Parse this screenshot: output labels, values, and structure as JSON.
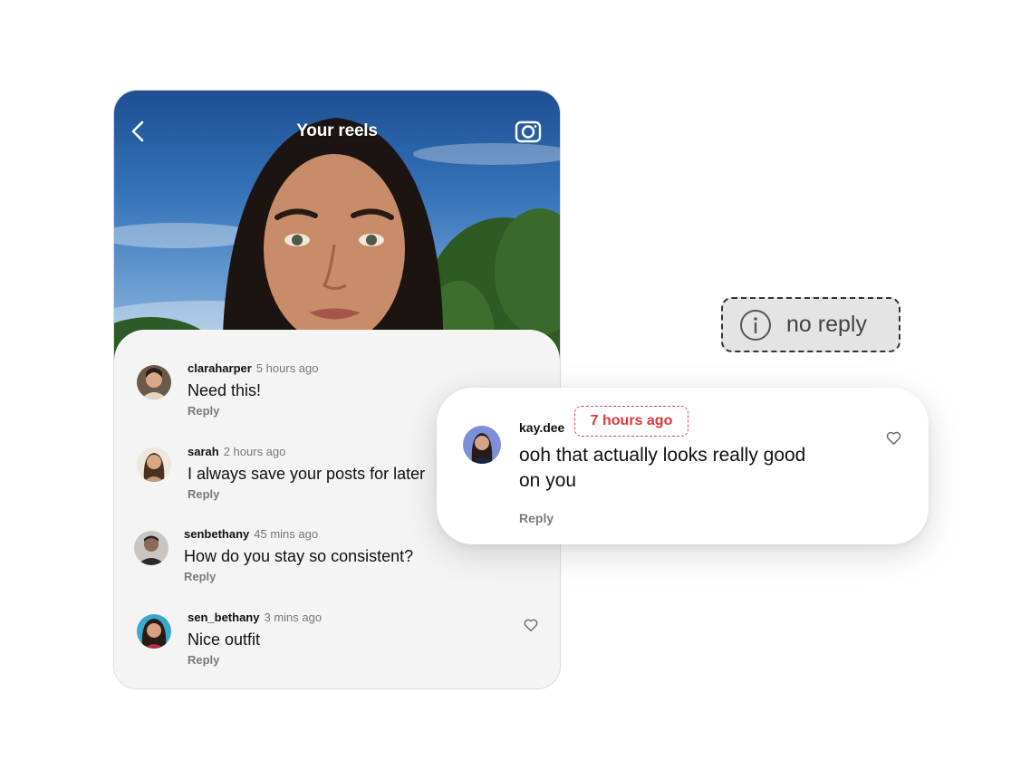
{
  "header": {
    "title": "Your reels"
  },
  "comments": [
    {
      "user": "claraharper",
      "time": "5 hours ago",
      "text": "Need this!",
      "reply": "Reply"
    },
    {
      "user": "sarah",
      "time": "2 hours ago",
      "text": "I always save your posts for later",
      "reply": "Reply"
    },
    {
      "user": "senbethany",
      "time": "45 mins ago",
      "text": "How do you stay so consistent?",
      "reply": "Reply"
    },
    {
      "user": "sen_bethany",
      "time": "3 mins ago",
      "text": "Nice outfit",
      "reply": "Reply"
    }
  ],
  "status_pill": {
    "icon": "info-icon",
    "text": "no reply"
  },
  "highlight": {
    "user": "kay.dee",
    "time": "7 hours ago",
    "text": "ooh that actually looks really good on you",
    "reply": "Reply"
  },
  "colors": {
    "accent_red": "#e0343a",
    "sheet_bg": "#f4f4f4"
  }
}
